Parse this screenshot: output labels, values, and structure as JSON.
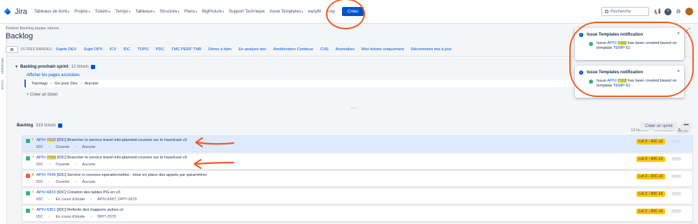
{
  "nav": {
    "brand": "Jira",
    "items": [
      "Tableaux de bord",
      "Projets",
      "Tickets",
      "Tempo",
      "Tableaux",
      "Structure",
      "Plans",
      "BigPicture",
      "Support Technique",
      "Issue Templates",
      "eazyBI",
      "Xray"
    ],
    "create_label": "Créer",
    "search_placeholder": "Recherche"
  },
  "rail": {
    "versions": "VERSIONS",
    "epics": "EPICS"
  },
  "breadcrumb": "Product Backlog équipe interne",
  "page_title": "Backlog",
  "quick_filters": {
    "label": "FILTRES RAPIDES:",
    "items": [
      "Sujets DEV",
      "Sujet OPS",
      "ICV",
      "IDC",
      "TOPO",
      "PDC",
      "TMC PERF TNR",
      "Démo à faire",
      "En analyse dev",
      "Amélioration Continue",
      "CVE",
      "Anomalies",
      "Mes tickets uniquement",
      "Récemment mis à jour"
    ]
  },
  "sprint": {
    "name": "Backlog prochain sprint",
    "count": "12 tickets",
    "linked_pages": "Afficher les pages associées",
    "row": {
      "epic": "Topology",
      "sep": "-",
      "label": "Go pour Dev",
      "sep2": "-",
      "value": "Aucune"
    },
    "add_ticket": "+ Créer un ticket",
    "dots": "...",
    "footer_count": "12 tickets",
    "estimation_label": "Estimation",
    "estimation_value": "1w 3d"
  },
  "backlog": {
    "title": "Backlog",
    "count": "319 tickets",
    "create_sprint": "Créer un sprint",
    "more": "•••",
    "issues": [
      {
        "key_prefix": "APIV-",
        "key_hl": "7102",
        "summary": "[IDC] Brancher le service travel-info-planned-courses sur le hazelcast v3",
        "component": "IDC",
        "sep": "-",
        "status": "Ouverte",
        "sep2": "-",
        "extra": "Aucune",
        "lot": "Lot 2 - IDC v3"
      },
      {
        "key_prefix": "APIV-",
        "key_hl": "7103",
        "summary": "[IDC] Brancher le service travel-info-planned-courses sur le hazelcast v3",
        "component": "IDC",
        "sep": "-",
        "status": "Ouverte",
        "sep2": "-",
        "extra": "Aucune",
        "lot": "Lot 2 - IDC v3"
      },
      {
        "key_prefix": "APIV-7049",
        "key_hl": "",
        "summary": "[IDC] Service iv-courses-operationnelles : mise en place des appels par paramètres",
        "component": "IDC",
        "sep": "-",
        "status": "Ouverte",
        "sep2": "-",
        "extra": "Aucune",
        "lot": "Lot 2 - IDC v3"
      },
      {
        "key_prefix": "APIV-6823",
        "key_hl": "",
        "summary": "[IDC] Création des tables PG en v3",
        "component": "IDC",
        "sep": "-",
        "status": "En cours d'étude",
        "sep2": "-",
        "extra": "APIV-6997, DPIT-2670",
        "lot": "Lot 2 - IDC v3"
      },
      {
        "key_prefix": "APIV-6361",
        "key_hl": "",
        "summary": "[IDC] Refonte des mappers autres-ot",
        "component": "IDC",
        "sep": "-",
        "status": "En cours d'étude",
        "sep2": "-",
        "extra": "DPIT-2070",
        "lot": "Lot 2 - IDC v3"
      }
    ]
  },
  "notifications": [
    {
      "title": "Issue Templates notification",
      "pre": "Issue ",
      "key_prefix": "APIV-",
      "key_hl": "7102",
      "mid": " has been created based on template ",
      "template": "TEMP-62",
      "close": "×"
    },
    {
      "title": "Issue Templates notification",
      "pre": "Issue ",
      "key_prefix": "APIV-",
      "key_hl": "7103",
      "mid": " has been created based on template ",
      "template": "TEMP-62",
      "close": "×"
    }
  ],
  "colors": {
    "accent": "#0052cc",
    "annotation": "#f15a24",
    "highlight": "#ffeb3b",
    "lot_badge": "#ffc400"
  }
}
